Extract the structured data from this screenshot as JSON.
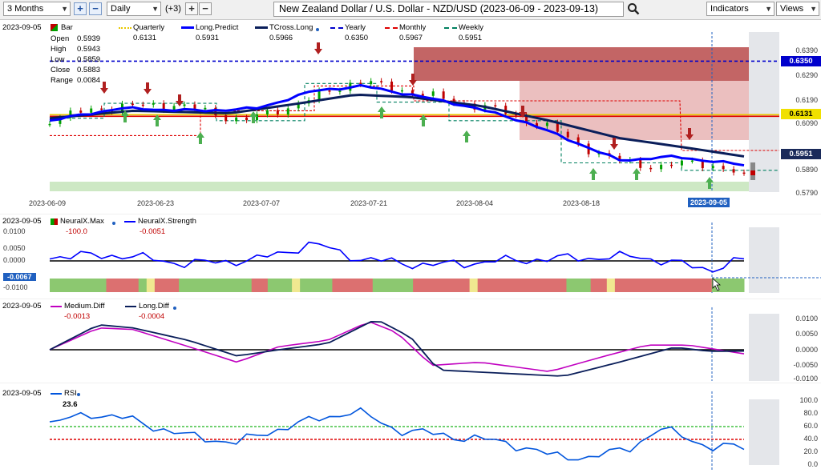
{
  "toolbar": {
    "range": "3 Months",
    "interval": "Daily",
    "overlay_count": "(+3)",
    "title": "New Zealand Dollar / U.S. Dollar - NZD/USD (2023-06-09 - 2023-09-13)",
    "indicators_label": "Indicators",
    "views_label": "Views"
  },
  "colors": {
    "long_predict": "#0000ff",
    "tcross_long": "#0a1e5a",
    "yearly": "#0000cc",
    "monthly": "#dd0000",
    "weekly": "#008060",
    "quarterly": "#e8c800",
    "up_bar": "#00a000",
    "down_bar": "#c00000",
    "selection": "#2060c0"
  },
  "price_pane": {
    "date": "2023-09-05",
    "bar_label": "Bar",
    "open_label": "Open",
    "open": "0.5939",
    "high_label": "High",
    "high": "0.5943",
    "low_label": "Low",
    "low": "0.5859",
    "close_label": "Close",
    "close": "0.5883",
    "range_label": "Range",
    "range": "0.0084",
    "legend": [
      {
        "name": "Quarterly",
        "value": "0.6131",
        "style": "dotted-yellow"
      },
      {
        "name": "Long.Predict",
        "value": "0.5931",
        "style": "solid-blue"
      },
      {
        "name": "TCross.Long",
        "value": "0.5966",
        "style": "solid-navy"
      },
      {
        "name": "Yearly",
        "value": "0.6350",
        "style": "dashed-blue"
      },
      {
        "name": "Monthly",
        "value": "0.5967",
        "style": "dashed-red"
      },
      {
        "name": "Weekly",
        "value": "0.5951",
        "style": "dashed-green"
      }
    ],
    "y_ticks": [
      "0.6390",
      "0.6290",
      "0.6190",
      "0.6090",
      "0.5890",
      "0.5790"
    ],
    "x_ticks": [
      "2023-06-09",
      "2023-06-23",
      "2023-07-07",
      "2023-07-21",
      "2023-08-04",
      "2023-08-18",
      "2023-09-05"
    ],
    "tags": {
      "yearly": "0.6350",
      "quarterly": "0.6131",
      "weekly": "0.5951"
    }
  },
  "strength_pane": {
    "date": "2023-09-05",
    "legend": [
      {
        "name": "NeuralX.Max",
        "value": "-100.0"
      },
      {
        "name": "NeuralX.Strength",
        "value": "-0.0051"
      }
    ],
    "y_ticks": [
      "0.0100",
      "0.0050",
      "0.0000",
      "-0.0050",
      "-0.0100"
    ],
    "current": "-0.0067"
  },
  "diff_pane": {
    "date": "2023-09-05",
    "legend": [
      {
        "name": "Medium.Diff",
        "value": "-0.0013"
      },
      {
        "name": "Long.Diff",
        "value": "-0.0004"
      }
    ],
    "y_ticks": [
      "0.0100",
      "0.0050",
      "0.0000",
      "-0.0050",
      "-0.0100"
    ]
  },
  "rsi_pane": {
    "date": "2023-09-05",
    "legend": [
      {
        "name": "RSI",
        "value": "23.6"
      }
    ],
    "y_ticks": [
      "100.0",
      "80.0",
      "60.0",
      "40.0",
      "20.0",
      "0.0"
    ]
  }
}
